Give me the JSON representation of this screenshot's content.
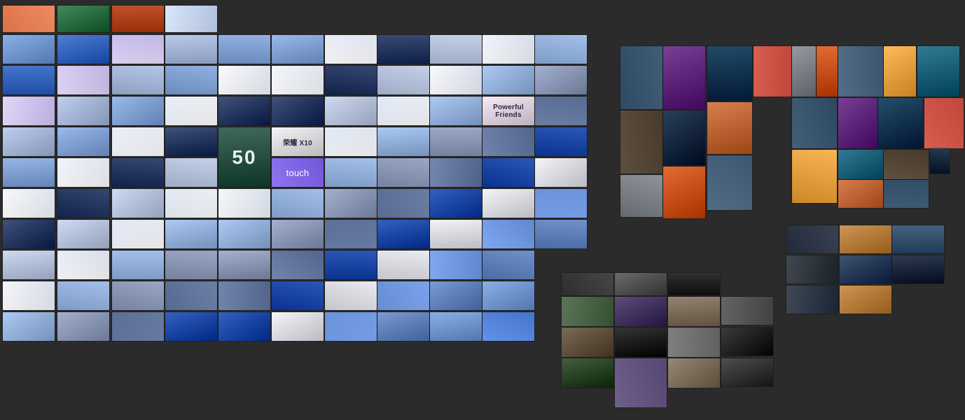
{
  "canvas": {
    "background": "#2b2b2b",
    "clusters": [
      {
        "id": "ui-tech-moodboard",
        "palette": [
          "#7ea7e6",
          "#c9d6f2",
          "#5a86d6",
          "#e6ecf8",
          "#1d4fb8",
          "#b7c9ee",
          "#9aa8c9",
          "#3b6fd1",
          "#dfe7f6",
          "#6b8fcf",
          "#2a3e6b",
          "#f2f4fa",
          "#8fb2ea",
          "#4a5f8a",
          "#c3b6ee",
          "#a3c4f3"
        ],
        "highlights": [
          {
            "name": "thumb-touch",
            "text": "touch",
            "color": "#6a4fe0"
          },
          {
            "name": "thumb-honor-x10",
            "text": "荣耀 X10",
            "color": "#f3f3f6"
          },
          {
            "name": "thumb-50",
            "text": "50",
            "color": "#2e5a4c"
          },
          {
            "name": "thumb-powerful-friends",
            "text": "Powerful Friends",
            "color": "#f5e8f6"
          }
        ]
      },
      {
        "id": "moody-interiors",
        "palette": [
          "#1c3b57",
          "#e05a1c",
          "#0f2c45",
          "#c0392b",
          "#1a6b86",
          "#6a2a8a",
          "#2d4a66",
          "#d2703a",
          "#8a8f96",
          "#3a2a1a",
          "#0b3a5a",
          "#ffb347"
        ]
      },
      {
        "id": "keyboard-gaming",
        "palette": [
          "#1e1e1e",
          "#2f4a2a",
          "#3a3a3a",
          "#5a5a5a",
          "#4a3a6a",
          "#6a5a44",
          "#252525",
          "#8a7a64"
        ]
      },
      {
        "id": "dark-tech-render",
        "palette": [
          "#0f1a2a",
          "#1b2a40",
          "#2a4060",
          "#101820",
          "#3a5a7a",
          "#c88a40"
        ]
      }
    ]
  }
}
